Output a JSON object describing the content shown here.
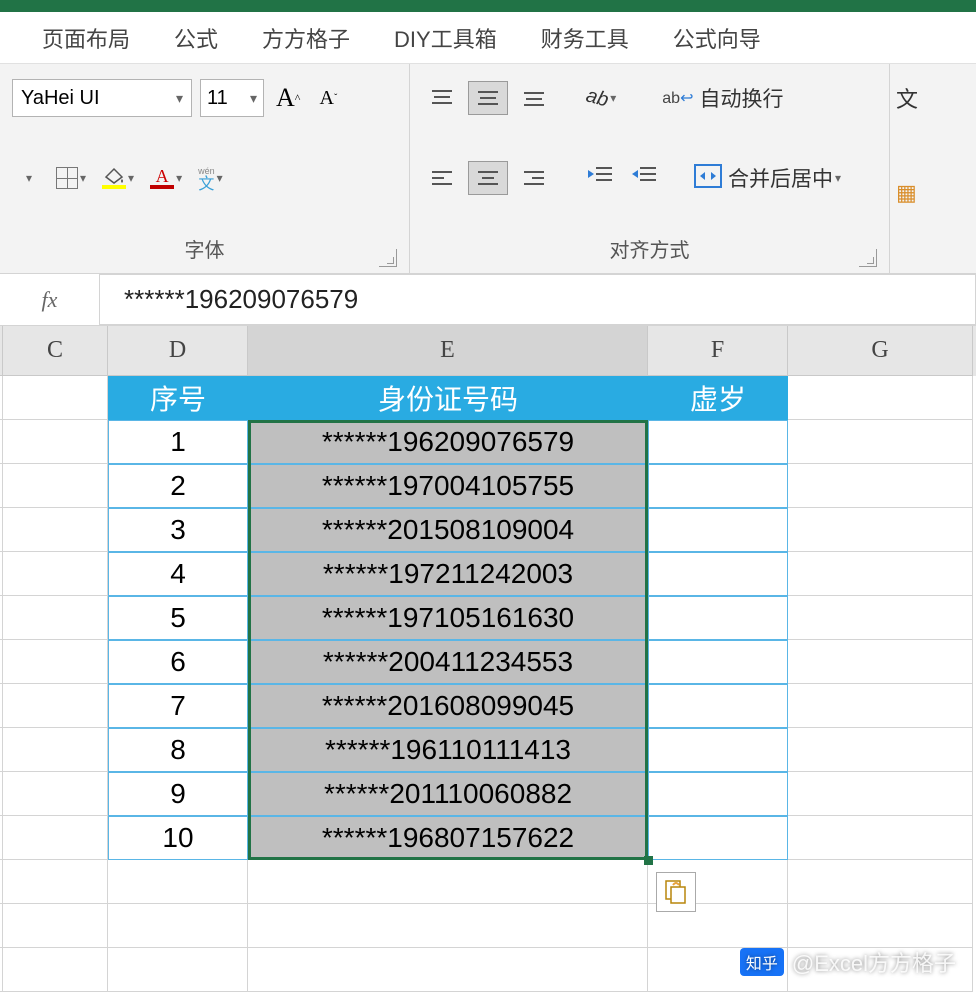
{
  "ribbon": {
    "tabs": [
      "页面布局",
      "公式",
      "方方格子",
      "DIY工具箱",
      "财务工具",
      "公式向导"
    ],
    "font": {
      "name": "YaHei UI",
      "size": "11",
      "group_label": "字体"
    },
    "alignment": {
      "group_label": "对齐方式",
      "wrap_label": "自动换行",
      "merge_label": "合并后居中"
    },
    "right_cut": {
      "text1": "文",
      "icon_char": "▣"
    }
  },
  "formula_bar": {
    "fx": "fx",
    "value": "******196209076579"
  },
  "columns": [
    "C",
    "D",
    "E",
    "F",
    "G"
  ],
  "headers": {
    "d": "序号",
    "e": "身份证号码",
    "f": "虚岁"
  },
  "rows": [
    {
      "seq": "1",
      "id": "******196209076579",
      "age": ""
    },
    {
      "seq": "2",
      "id": "******197004105755",
      "age": ""
    },
    {
      "seq": "3",
      "id": "******201508109004",
      "age": ""
    },
    {
      "seq": "4",
      "id": "******197211242003",
      "age": ""
    },
    {
      "seq": "5",
      "id": "******197105161630",
      "age": ""
    },
    {
      "seq": "6",
      "id": "******200411234553",
      "age": ""
    },
    {
      "seq": "7",
      "id": "******201608099045",
      "age": ""
    },
    {
      "seq": "8",
      "id": "******196110111413",
      "age": ""
    },
    {
      "seq": "9",
      "id": "******201110060882",
      "age": ""
    },
    {
      "seq": "10",
      "id": "******196807157622",
      "age": ""
    }
  ],
  "watermark": {
    "logo": "知乎",
    "text": "@Excel方方格子"
  }
}
